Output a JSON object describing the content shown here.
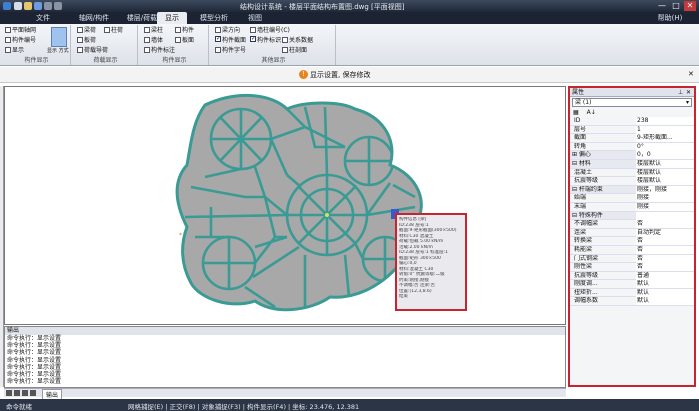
{
  "window": {
    "title": "结构设计系统 - 楼层平面结构布置图.dwg [平面视图]",
    "help_label": "帮助(H)",
    "min": "—",
    "max": "□",
    "close": "✕"
  },
  "tabs": [
    "文件",
    "轴网/构件",
    "楼层/荷载",
    "显示",
    "模型分析",
    "视图"
  ],
  "active_tab": 3,
  "ribbon": {
    "groups": [
      {
        "label": "构件显示",
        "items": [
          "平面轴网",
          "构件编号",
          "显示"
        ],
        "btn": "显示 方式"
      },
      {
        "label": "荷载显示",
        "items": [
          "梁荷",
          "柱荷",
          "板荷",
          "荷载导荷"
        ]
      },
      {
        "label": "构件显示",
        "items": [
          "梁柱",
          "构件",
          "墙体",
          "板面",
          "构件标注"
        ]
      },
      {
        "label": "其他显示",
        "items": [
          "梁方向",
          "构件截面",
          "构件字号",
          "墙柱编号(C)",
          "构件标识",
          "关系数据",
          "柱剖面"
        ]
      }
    ]
  },
  "info_bar": {
    "icon": "!",
    "message": "显示设置, 保存修改"
  },
  "tooltip": {
    "lines": [
      "构件信息 [梁]",
      "ID:238 层号:1",
      "截面:9-矩形截面(300×500)",
      "材料:C30 混凝土",
      "荷载:恒载 5.00 kN/m",
      "活载:2.00 kN/m",
      "ID:238 层号:1 标准层:1",
      "截面:矩形 300×500",
      "偏心:0,0",
      "材料:混凝土 C30",
      "转角:0° 抗震等级:二级",
      "约束:刚接,刚接",
      "不调幅:否 连梁:否",
      "位置:(12.3,8.6)",
      "结束"
    ]
  },
  "properties": {
    "header": "属性",
    "selector": "梁 (1)",
    "rows": [
      {
        "k": "ID",
        "v": "238"
      },
      {
        "k": "层号",
        "v": "1"
      },
      {
        "k": "截面",
        "v": "9-矩形截面..."
      },
      {
        "k": "转角",
        "v": "0°"
      },
      {
        "k": "⊞ 偏心",
        "v": "0，0",
        "cat": true
      },
      {
        "k": "⊟ 材料",
        "v": "楼层默认",
        "cat": true
      },
      {
        "k": "   混凝土",
        "v": "楼层默认"
      },
      {
        "k": "抗震等级",
        "v": "楼层默认"
      },
      {
        "k": "⊟ 杆端约束",
        "v": "刚接，刚接",
        "cat": true
      },
      {
        "k": "   始端",
        "v": "刚接"
      },
      {
        "k": "   末端",
        "v": "刚接"
      },
      {
        "k": "⊟ 特殊构件",
        "v": "",
        "cat": true
      },
      {
        "k": "不调幅梁",
        "v": "否"
      },
      {
        "k": "连梁",
        "v": "自动判定"
      },
      {
        "k": "转换梁",
        "v": "否"
      },
      {
        "k": "耗能梁",
        "v": "否"
      },
      {
        "k": "门式钢梁",
        "v": "否"
      },
      {
        "k": "刚性梁",
        "v": "否"
      },
      {
        "k": "抗震等级",
        "v": "普通"
      },
      {
        "k": "刚度调...",
        "v": "默认"
      },
      {
        "k": "扭矩折...",
        "v": "默认"
      },
      {
        "k": "调幅系数",
        "v": "默认"
      }
    ]
  },
  "output": {
    "header": "输出",
    "lines": [
      "命令执行：显示设置",
      "命令执行：显示设置",
      "命令执行：显示设置",
      "命令执行：显示设置",
      "命令执行：显示设置",
      "命令执行：显示设置",
      "命令执行：显示设置"
    ],
    "tab": "输出"
  },
  "status": {
    "left": "命令就绪",
    "right": "网格捕捉(E) | 正交(F8) | 对象捕捉(F3) | 构件显示(F4) | 坐标: 23.476, 12.381"
  },
  "colors": {
    "accent": "#c8242f",
    "beam": "#3a9a94",
    "slab": "#a8a8a8"
  }
}
